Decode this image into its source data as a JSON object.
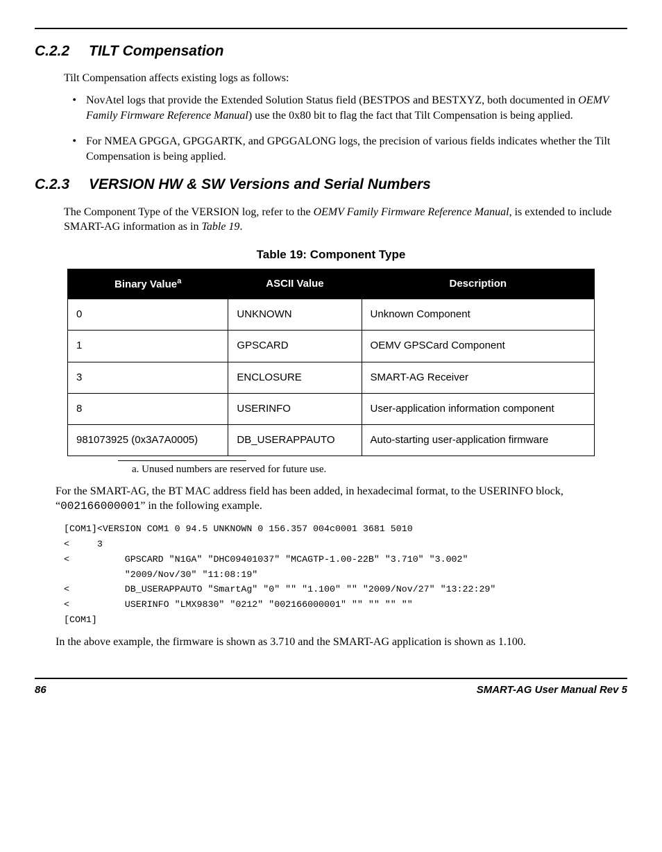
{
  "section1": {
    "number": "C.2.2",
    "title": "TILT Compensation",
    "intro": "Tilt Compensation affects existing logs as follows:",
    "bullets": [
      {
        "pre": "NovAtel logs that provide the Extended Solution Status field (BESTPOS and BESTXYZ, both documented in ",
        "em": "OEMV Family Firmware Reference Manual",
        "post": ") use the 0x80 bit to flag the fact that Tilt Compensation is being applied."
      },
      {
        "pre": "For NMEA GPGGA, GPGGARTK, and GPGGALONG logs, the precision of various fields indicates whether the Tilt Compensation is being applied.",
        "em": "",
        "post": ""
      }
    ]
  },
  "section2": {
    "number": "C.2.3",
    "title": "VERSION HW & SW Versions and Serial Numbers",
    "para_pre": "The Component Type of the VERSION log, refer to the ",
    "para_em": "OEMV Family Firmware Reference Manual",
    "para_mid": ", is extended to include SMART-AG information as in ",
    "para_em2": "Table 19",
    "para_post": ".",
    "table_caption": "Table 19:  Component Type",
    "headers": {
      "c1": "Binary Value",
      "c1sup": "a",
      "c2": "ASCII Value",
      "c3": "Description"
    },
    "rows": [
      {
        "bin": "0",
        "ascii": "UNKNOWN",
        "desc": "Unknown Component"
      },
      {
        "bin": "1",
        "ascii": "GPSCARD",
        "desc": "OEMV GPSCard Component"
      },
      {
        "bin": "3",
        "ascii": "ENCLOSURE",
        "desc": "SMART-AG Receiver"
      },
      {
        "bin": "8",
        "ascii": "USERINFO",
        "desc": "User-application information component"
      },
      {
        "bin": "981073925 (0x3A7A0005)",
        "ascii": "DB_USERAPPAUTO",
        "desc": "Auto-starting user-application firmware"
      }
    ],
    "footnote": "a. Unused numbers are reserved for future use.",
    "after_table_pre": "For the SMART-AG, the BT MAC address field has been added, in hexadecimal format, to the USERINFO block, “",
    "after_table_mono": "002166000001",
    "after_table_post": "” in the following example.",
    "code": "[COM1]<VERSION COM1 0 94.5 UNKNOWN 0 156.357 004c0001 3681 5010\n<     3\n<          GPSCARD \"N1GA\" \"DHC09401037\" \"MCAGTP-1.00-22B\" \"3.710\" \"3.002\"\n           \"2009/Nov/30\" \"11:08:19\"\n<          DB_USERAPPAUTO \"SmartAg\" \"0\" \"\" \"1.100\" \"\" \"2009/Nov/27\" \"13:22:29\"\n<          USERINFO \"LMX9830\" \"0212\" \"002166000001\" \"\" \"\" \"\" \"\"\n[COM1]",
    "closing": "In the above example, the firmware is shown as 3.710 and the SMART-AG application is shown as 1.100."
  },
  "footer": {
    "page": "86",
    "book": "SMART-AG User Manual Rev 5"
  }
}
